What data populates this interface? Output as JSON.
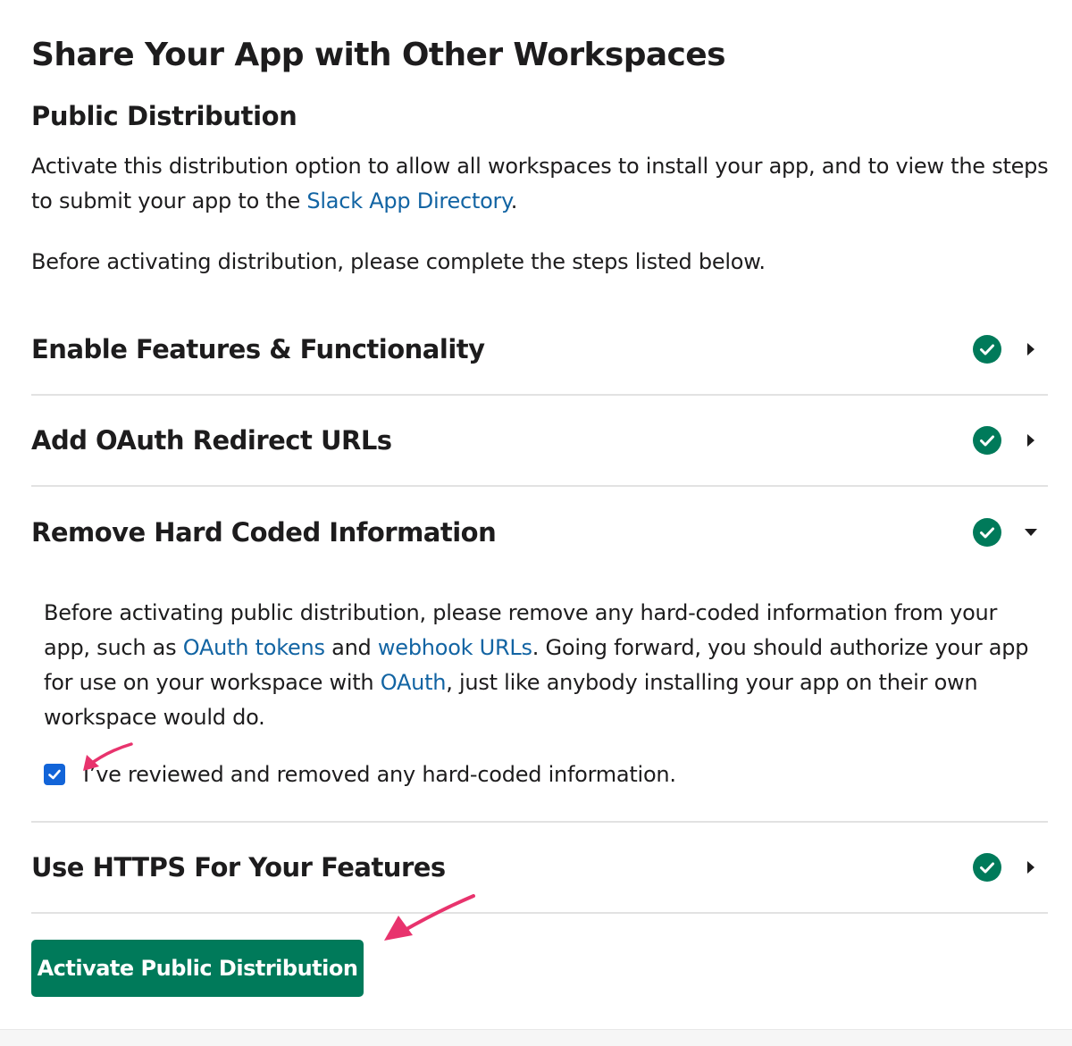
{
  "page": {
    "title": "Share Your App with Other Workspaces"
  },
  "public_distribution": {
    "heading": "Public Distribution",
    "intro_before_link": "Activate this distribution option to allow all workspaces to install your app, and to view the steps to submit your app to the ",
    "intro_link": "Slack App Directory",
    "intro_after_link": ".",
    "before_activating": "Before activating distribution, please complete the steps listed below."
  },
  "steps": [
    {
      "title": "Enable Features & Functionality",
      "status": "complete",
      "expanded": false
    },
    {
      "title": "Add OAuth Redirect URLs",
      "status": "complete",
      "expanded": false
    },
    {
      "title": "Remove Hard Coded Information",
      "status": "complete",
      "expanded": true
    },
    {
      "title": "Use HTTPS For Your Features",
      "status": "complete",
      "expanded": false
    }
  ],
  "hard_coded": {
    "text_1": "Before activating public distribution, please remove any hard-coded information from your app, such as ",
    "link_1": "OAuth tokens",
    "text_2": " and ",
    "link_2": "webhook URLs",
    "text_3": ". Going forward, you should authorize your app for use on your workspace with ",
    "link_3": "OAuth",
    "text_4": ", just like anybody installing your app on their own workspace would do.",
    "confirm_label": "I’ve reviewed and removed any hard-coded information.",
    "confirm_checked": true
  },
  "actions": {
    "activate_label": "Activate Public Distribution"
  },
  "colors": {
    "accent_green": "#007a5a",
    "check_green": "#007a5a",
    "link_blue": "#1264a3",
    "checkbox_blue": "#1264d8",
    "annotation_pink": "#e8336d"
  }
}
